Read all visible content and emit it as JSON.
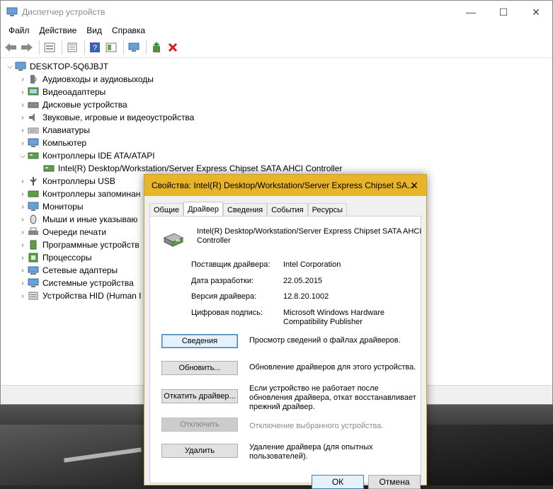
{
  "window": {
    "title": "Диспетчер устройств",
    "minimize": "—",
    "maximize": "☐",
    "close": "✕"
  },
  "menu": [
    "Файл",
    "Действие",
    "Вид",
    "Справка"
  ],
  "tree": {
    "root": "DESKTOP-5Q6JBJT",
    "items": [
      {
        "label": "Аудиовходы и аудиовыходы",
        "expanded": false
      },
      {
        "label": "Видеоадаптеры",
        "expanded": false
      },
      {
        "label": "Дисковые устройства",
        "expanded": false
      },
      {
        "label": "Звуковые, игровые и видеоустройства",
        "expanded": false
      },
      {
        "label": "Клавиатуры",
        "expanded": false
      },
      {
        "label": "Компьютер",
        "expanded": false
      },
      {
        "label": "Контроллеры IDE ATA/ATAPI",
        "expanded": true
      },
      {
        "label": "Intel(R) Desktop/Workstation/Server Express Chipset SATA AHCI Controller",
        "child": true
      },
      {
        "label": "Контроллеры USB",
        "expanded": false
      },
      {
        "label": "Контроллеры запоминан",
        "expanded": false
      },
      {
        "label": "Мониторы",
        "expanded": false
      },
      {
        "label": "Мыши и иные указываю",
        "expanded": false
      },
      {
        "label": "Очереди печати",
        "expanded": false
      },
      {
        "label": "Программные устройств",
        "expanded": false
      },
      {
        "label": "Процессоры",
        "expanded": false
      },
      {
        "label": "Сетевые адаптеры",
        "expanded": false
      },
      {
        "label": "Системные устройства",
        "expanded": false
      },
      {
        "label": "Устройства HID (Human I",
        "expanded": false
      }
    ]
  },
  "dialog": {
    "title": "Свойства: Intel(R) Desktop/Workstation/Server Express Chipset SA...",
    "close": "✕",
    "tabs": [
      "Общие",
      "Драйвер",
      "Сведения",
      "События",
      "Ресурсы"
    ],
    "active_tab": 1,
    "device_name": "Intel(R) Desktop/Workstation/Server Express Chipset SATA AHCI Controller",
    "props": [
      {
        "label": "Поставщик драйвера:",
        "value": "Intel Corporation"
      },
      {
        "label": "Дата разработки:",
        "value": "22.05.2015"
      },
      {
        "label": "Версия драйвера:",
        "value": "12.8.20.1002"
      },
      {
        "label": "Цифровая подпись:",
        "value": "Microsoft Windows Hardware Compatibility Publisher"
      }
    ],
    "actions": [
      {
        "label": "Сведения",
        "desc": "Просмотр сведений о файлах драйверов."
      },
      {
        "label": "Обновить...",
        "desc": "Обновление драйверов для этого устройства."
      },
      {
        "label": "Откатить драйвер...",
        "desc": "Если устройство не работает после обновления драйвера, откат восстанавливает прежний драйвер."
      },
      {
        "label": "Отключить",
        "desc": "Отключение выбранного устройства."
      },
      {
        "label": "Удалить",
        "desc": "Удаление драйвера (для опытных пользователей)."
      }
    ],
    "ok": "ОК",
    "cancel": "Отмена"
  }
}
